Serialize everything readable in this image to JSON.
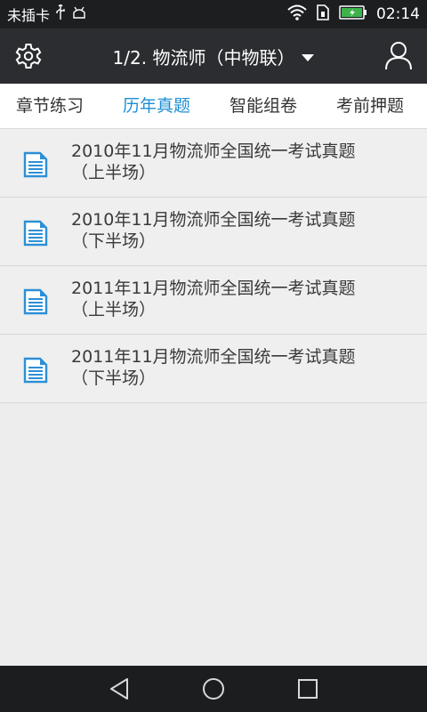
{
  "status_bar": {
    "carrier": "未插卡",
    "time": "02:14"
  },
  "app_bar": {
    "title": "1/2. 物流师（中物联）",
    "settings_icon": "gear-icon",
    "user_icon": "user-icon"
  },
  "tabs": [
    {
      "label": "章节练习",
      "active": false
    },
    {
      "label": "历年真题",
      "active": true
    },
    {
      "label": "智能组卷",
      "active": false
    },
    {
      "label": "考前押题",
      "active": false
    }
  ],
  "items": [
    {
      "line1": "2010年11月物流师全国统一考试真题",
      "line2": "（上半场）"
    },
    {
      "line1": "2010年11月物流师全国统一考试真题",
      "line2": "（下半场）"
    },
    {
      "line1": "2011年11月物流师全国统一考试真题",
      "line2": "（上半场）"
    },
    {
      "line1": "2011年11月物流师全国统一考试真题",
      "line2": "（下半场）"
    }
  ],
  "colors": {
    "accent": "#1f8ed3",
    "app_bar": "#2c2d30",
    "battery": "#3db44a"
  }
}
